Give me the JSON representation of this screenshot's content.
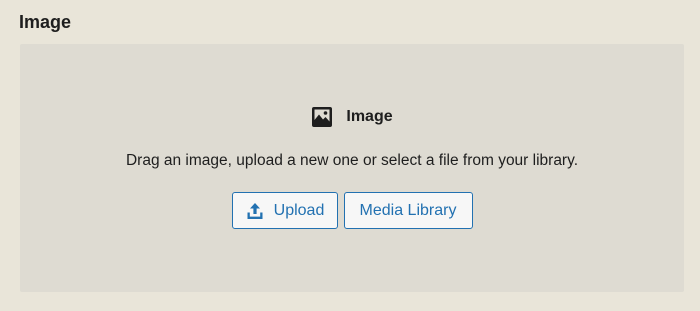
{
  "section": {
    "title": "Image"
  },
  "placeholder": {
    "label": "Image",
    "icon": "image-icon",
    "instructions": "Drag an image, upload a new one or select a file from your library.",
    "upload_label": "Upload",
    "upload_icon": "upload-icon",
    "media_library_label": "Media Library"
  },
  "colors": {
    "background": "#e9e5d9",
    "placeholder_bg": "#dedbd2",
    "accent": "#2271b1"
  }
}
